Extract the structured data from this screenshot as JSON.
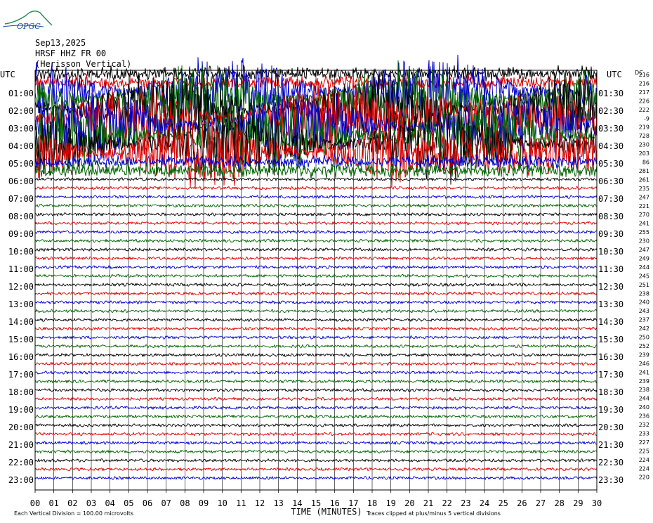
{
  "header": {
    "logo_text": "OPGC",
    "date": "Sep13,2025",
    "station": "HRSF HHZ FR 00",
    "site": "(Herisson Vertical)"
  },
  "colors": {
    "trace_cycle": [
      "#000000",
      "#dd0000",
      "#0000cc",
      "#006400"
    ],
    "grid": "#000000"
  },
  "chart_data": {
    "type": "line",
    "subtype": "helicorder",
    "left_label": "UTC",
    "right_label": "UTC",
    "dc_label": "DC",
    "xlabel": "TIME (MINUTES)",
    "x_ticks": [
      "00",
      "01",
      "02",
      "03",
      "04",
      "05",
      "06",
      "07",
      "08",
      "09",
      "10",
      "11",
      "12",
      "13",
      "14",
      "15",
      "16",
      "17",
      "18",
      "19",
      "20",
      "21",
      "22",
      "23",
      "24",
      "25",
      "26",
      "27",
      "28",
      "29",
      "30"
    ],
    "xlim": [
      0,
      30
    ],
    "left_times": [
      "01:00",
      "02:00",
      "03:00",
      "04:00",
      "05:00",
      "06:00",
      "07:00",
      "08:00",
      "09:00",
      "10:00",
      "11:00",
      "12:00",
      "13:00",
      "14:00",
      "15:00",
      "16:00",
      "17:00",
      "18:00",
      "19:00",
      "20:00",
      "21:00",
      "22:00",
      "23:00"
    ],
    "right_times": [
      "01:30",
      "02:30",
      "03:30",
      "04:30",
      "05:30",
      "06:30",
      "07:30",
      "08:30",
      "09:30",
      "10:30",
      "11:30",
      "12:30",
      "13:30",
      "14:30",
      "15:30",
      "16:30",
      "17:30",
      "18:30",
      "19:30",
      "20:30",
      "21:30",
      "22:30",
      "23:30"
    ],
    "dc_offsets": [
      "216",
      "216",
      "217",
      "226",
      "222",
      "-9",
      "219",
      "728",
      "230",
      "203",
      "86",
      "281",
      "261",
      "235",
      "247",
      "221",
      "270",
      "241",
      "255",
      "230",
      "247",
      "249",
      "244",
      "245",
      "251",
      "238",
      "240",
      "243",
      "237",
      "242",
      "250",
      "252",
      "239",
      "246",
      "241",
      "239",
      "238",
      "244",
      "240",
      "236",
      "232",
      "233",
      "227",
      "225",
      "224",
      "224",
      "220"
    ],
    "trace_count": 47,
    "minutes_per_trace": 30,
    "activity_window": {
      "start_trace": 0,
      "end_trace": 11,
      "peak_start_trace": 2,
      "peak_end_trace": 9
    },
    "footer_left": "Each Vertical Division =  100.00 microvolts",
    "footer_right": "Traces clipped at plus/minus 5 vertical divisions"
  }
}
